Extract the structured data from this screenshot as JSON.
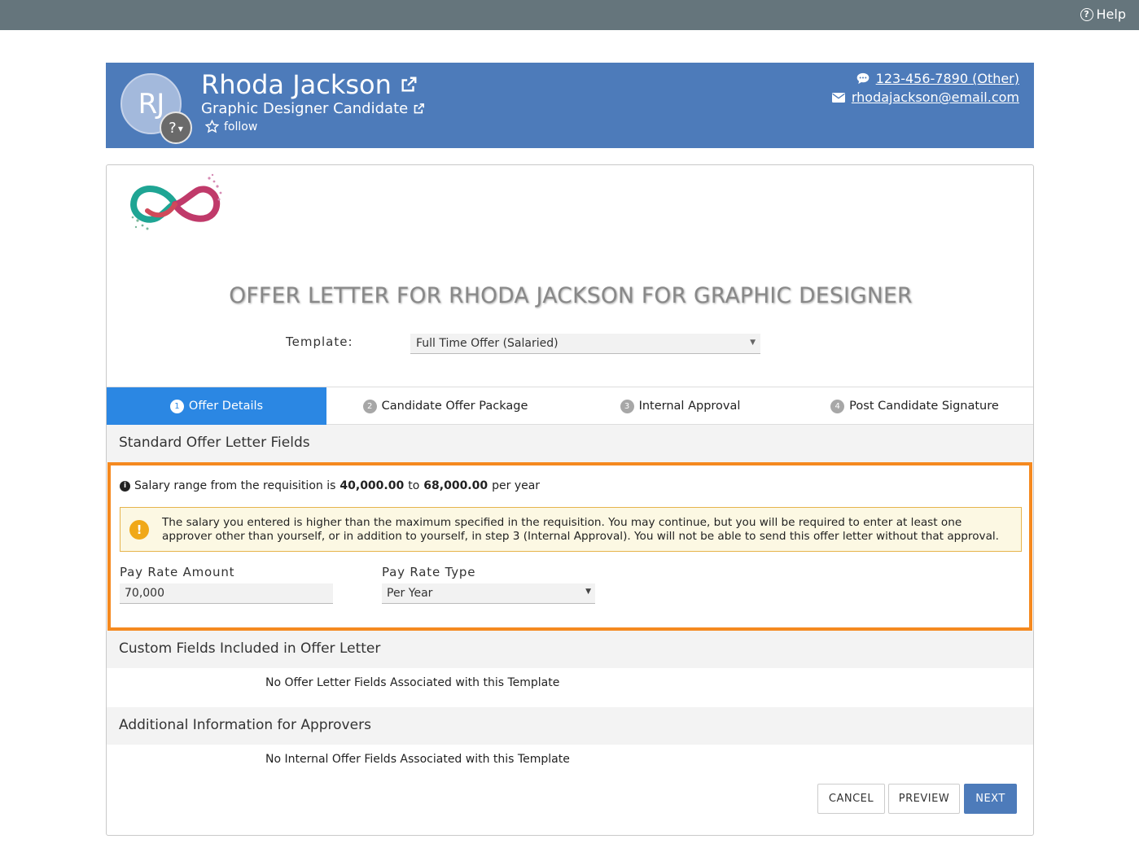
{
  "topbar": {
    "help_label": "Help",
    "help_icon": "question-circle-icon"
  },
  "profile": {
    "initials": "RJ",
    "badge_label": "?",
    "name": "Rhoda Jackson",
    "job_title": "Graphic Designer Candidate",
    "follow_label": "follow",
    "phone": "123-456-7890 (Other)",
    "email": "rhodajackson@email.com",
    "background_color": "#4d7bba"
  },
  "offer": {
    "title": "OFFER LETTER FOR RHODA JACKSON FOR GRAPHIC DESIGNER",
    "template_label": "Template:",
    "template_value": "Full Time Offer (Salaried)"
  },
  "tabs": [
    {
      "num": "1",
      "label": "Offer Details",
      "active": true
    },
    {
      "num": "2",
      "label": "Candidate Offer Package",
      "active": false
    },
    {
      "num": "3",
      "label": "Internal Approval",
      "active": false
    },
    {
      "num": "4",
      "label": "Post Candidate Signature",
      "active": false
    }
  ],
  "standard": {
    "heading": "Standard Offer Letter Fields",
    "salary_prefix": "Salary range from the requisition is",
    "salary_min": "40,000.00",
    "salary_to": "to",
    "salary_max": "68,000.00",
    "salary_suffix": "per year",
    "warning_text": "The salary you entered is higher than the maximum specified in the requisition. You may continue, but you will be required to enter at least one approver other than yourself, or in addition to yourself, in step 3 (Internal Approval). You will not be able to send this offer letter without that approval.",
    "pay_rate_amount_label": "Pay Rate Amount",
    "pay_rate_amount_value": "70,000",
    "pay_rate_type_label": "Pay Rate Type",
    "pay_rate_type_value": "Per Year",
    "highlight_color": "#f5891f"
  },
  "custom": {
    "heading": "Custom Fields Included in Offer Letter",
    "empty": "No Offer Letter Fields Associated with this Template"
  },
  "additional": {
    "heading": "Additional Information for Approvers",
    "empty": "No Internal Offer Fields Associated with this Template"
  },
  "actions": {
    "cancel": "CANCEL",
    "preview": "PREVIEW",
    "next": "NEXT"
  },
  "colors": {
    "active_tab": "#2b87e3",
    "primary_button": "#4d7bba",
    "topbar": "#65757c"
  }
}
